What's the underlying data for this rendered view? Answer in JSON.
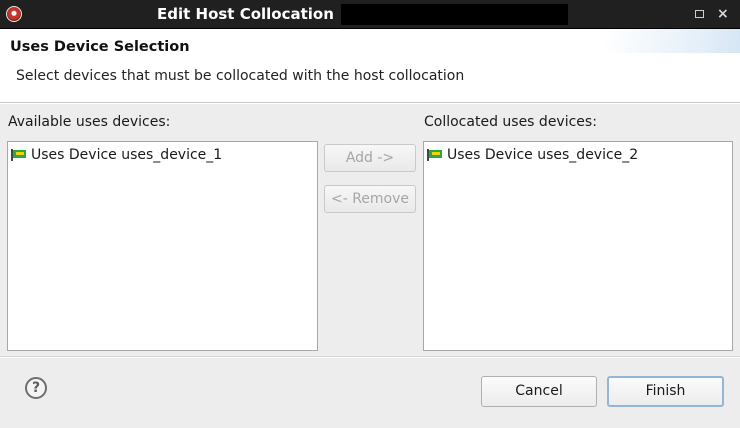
{
  "window": {
    "title": "Edit Host Collocation",
    "icons": {
      "app": "app-logo-icon",
      "maximize": "maximize-icon",
      "close": "close-icon"
    },
    "close_glyph": "×"
  },
  "header": {
    "title": "Uses Device Selection",
    "subtitle": "Select devices that must be collocated with the host collocation"
  },
  "available": {
    "label": "Available uses devices:",
    "items": [
      {
        "label": "Uses Device uses_device_1",
        "icon": "flag-icon"
      }
    ]
  },
  "collocated": {
    "label": "Collocated uses devices:",
    "items": [
      {
        "label": "Uses Device uses_device_2",
        "icon": "flag-icon"
      }
    ]
  },
  "actions": {
    "add_label": "Add ->",
    "remove_label": "<- Remove",
    "add_enabled": false,
    "remove_enabled": false
  },
  "footer": {
    "help_glyph": "?",
    "help_icon": "help-icon",
    "cancel_label": "Cancel",
    "finish_label": "Finish"
  },
  "colors": {
    "titlebar": "#202020",
    "dialog_bg": "#ededed",
    "finish_border": "#93b6d6",
    "flag_green": "#2fa83a",
    "flag_yellow": "#f2d10b"
  }
}
